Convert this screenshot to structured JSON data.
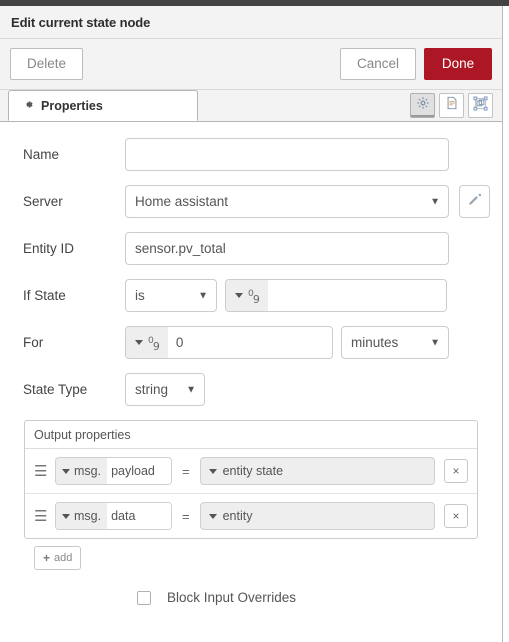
{
  "dialog": {
    "title": "Edit current state node",
    "buttons": {
      "delete": "Delete",
      "cancel": "Cancel",
      "done": "Done"
    },
    "accent_color": "#ad1625",
    "header_bg": "#f3f3f3"
  },
  "tabs": {
    "active": "Properties",
    "items": [
      {
        "label": "Properties",
        "icon": "gear-icon"
      }
    ],
    "icon_buttons": [
      {
        "name": "properties-icon",
        "glyph": "gear",
        "active": true
      },
      {
        "name": "description-icon",
        "glyph": "document",
        "active": false
      },
      {
        "name": "appearance-icon",
        "glyph": "object-group",
        "active": false
      }
    ]
  },
  "form": {
    "name": {
      "label": "Name",
      "value": "",
      "placeholder": ""
    },
    "server": {
      "label": "Server",
      "value": "Home assistant",
      "options": [
        "Home assistant"
      ],
      "edit_button_icon": "pencil-icon"
    },
    "entity_id": {
      "label": "Entity ID",
      "value": "sensor.pv_total",
      "placeholder": ""
    },
    "if_state": {
      "label": "If State",
      "comparator": "is",
      "comparator_options": [
        "is"
      ],
      "type_icon": "number-type-icon",
      "value": "",
      "placeholder": ""
    },
    "for": {
      "label": "For",
      "type_icon": "number-type-icon",
      "value": "0",
      "units": "minutes",
      "units_options": [
        "minutes"
      ]
    },
    "state_type": {
      "label": "State Type",
      "value": "string",
      "options": [
        "string"
      ]
    }
  },
  "output_properties": {
    "legend": "Output properties",
    "rows": [
      {
        "property_scope": "msg.",
        "property_name": "payload",
        "equals": "=",
        "value_type": "entity state",
        "delete_label": "×"
      },
      {
        "property_scope": "msg.",
        "property_name": "data",
        "equals": "=",
        "value_type": "entity",
        "delete_label": "×"
      }
    ],
    "add_label": "add",
    "add_icon": "plus-icon"
  },
  "block_input_overrides": {
    "label": "Block Input Overrides",
    "checked": false
  }
}
